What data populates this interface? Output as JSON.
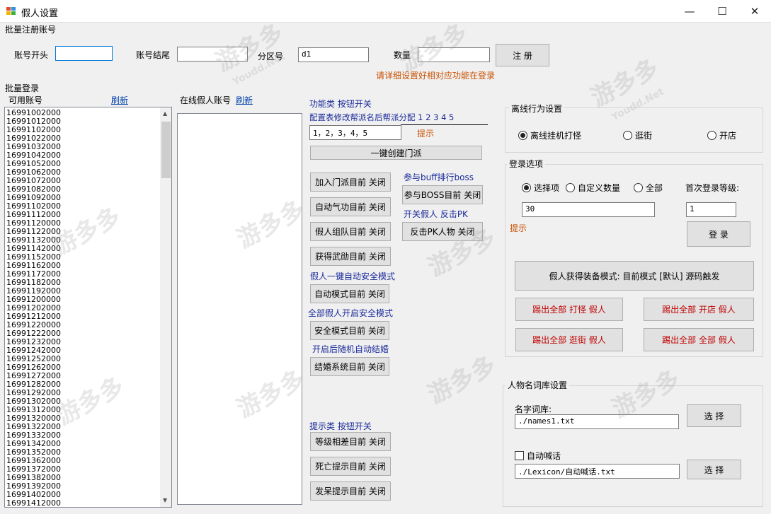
{
  "window": {
    "title": "假人设置",
    "controls": {
      "minimize": "—",
      "maximize": "☐",
      "close": "✕"
    }
  },
  "batch_register": {
    "section_label": "批量注册账号",
    "start_label": "账号开头",
    "start_value": "",
    "end_label": "账号结尾",
    "end_value": "",
    "zone_label": "分区号",
    "zone_value": "d1",
    "count_label": "数量",
    "count_value": "",
    "register_button": "注 册",
    "warning": "请详细设置好相对应功能在登录"
  },
  "batch_login": {
    "section_label": "批量登录",
    "available_label": "可用账号",
    "refresh_link": "刷新",
    "accounts": [
      "16991002000",
      "16991012000",
      "16991102000",
      "16991022000",
      "16991032000",
      "16991042000",
      "16991052000",
      "16991062000",
      "16991072000",
      "16991082000",
      "16991092000",
      "16991102000",
      "16991112000",
      "16991120000",
      "16991122000",
      "16991132000",
      "16991142000",
      "16991152000",
      "16991162000",
      "16991172000",
      "16991182000",
      "16991192000",
      "16991200000",
      "16991202000",
      "16991212000",
      "16991220000",
      "16991222000",
      "16991232000",
      "16991242000",
      "16991252000",
      "16991262000",
      "16991272000",
      "16991282000",
      "16991292000",
      "16991302000",
      "16991312000",
      "16991320000",
      "16991322000",
      "16991332000",
      "16991342000",
      "16991352000",
      "16991362000",
      "16991372000",
      "16991382000",
      "16991392000",
      "16991402000",
      "16991412000"
    ]
  },
  "online": {
    "label": "在线假人账号",
    "refresh_link": "刷新"
  },
  "functions": {
    "header": "功能类 按钮开关",
    "config_label": "配置表修改帮派名后帮派分配 1 2 3 4 5",
    "config_value": "1，2，3，4，5",
    "hint": "提示",
    "create_sect_button": "一键创建门派",
    "join_sect_button": "加入门派目前 关闭",
    "auto_qigong_button": "自动气功目前 关闭",
    "team_button": "假人组队目前 关闭",
    "medal_button": "获得武勋目前 关闭",
    "auto_safe_title": "假人一键自动安全模式",
    "auto_mode_button": "自动模式目前 关闭",
    "all_safe_title": "全部假人开启安全模式",
    "safe_mode_button": "安全模式目前 关闭",
    "marriage_title": "开启后随机自动结婚",
    "marriage_button": "结婚系统目前 关闭",
    "boss_title": "参与buff排行boss",
    "boss_button": "参与BOSS目前 关闭",
    "pk_title": "开关假人 反击PK",
    "pk_button": "反击PK人物 关闭"
  },
  "hints": {
    "header": "提示类 按钮开关",
    "level_diff_button": "等级相差目前 关闭",
    "death_button": "死亡提示目前 关闭",
    "idle_button": "发呆提示目前 关闭"
  },
  "offline": {
    "title": "离线行为设置",
    "options": [
      "离线挂机打怪",
      "逛街",
      "开店"
    ],
    "selected": "离线挂机打怪"
  },
  "login_options": {
    "title": "登录选项",
    "options": [
      "选择项",
      "自定义数量",
      "全部"
    ],
    "selected": "选择项",
    "first_level_label": "首次登录等级:",
    "count_value": "30",
    "level_value": "1",
    "hint": "提示",
    "login_button": "登 录",
    "equip_mode_button": "假人获得装备模式:  目前模式 [默认] 源码触发",
    "kick_monster": "踢出全部 打怪 假人",
    "kick_shop": "踢出全部 开店 假人",
    "kick_street": "踢出全部 逛街 假人",
    "kick_all": "踢出全部 全部 假人"
  },
  "names": {
    "title": "人物名词库设置",
    "lib_label": "名字词库:",
    "lib_value": "./names1.txt",
    "select_button": "选 择",
    "auto_shout_label": "自动喊话",
    "auto_shout_value": "./Lexicon/自动喊话.txt",
    "select_button2": "选 择"
  },
  "watermark": {
    "brand": "游多多",
    "domain": "Youdd.Net"
  },
  "colors": {
    "accent": "#0078d7",
    "kick_red": "#c00000",
    "hint_orange": "#c85000",
    "label_blue": "#1a2a9a"
  }
}
